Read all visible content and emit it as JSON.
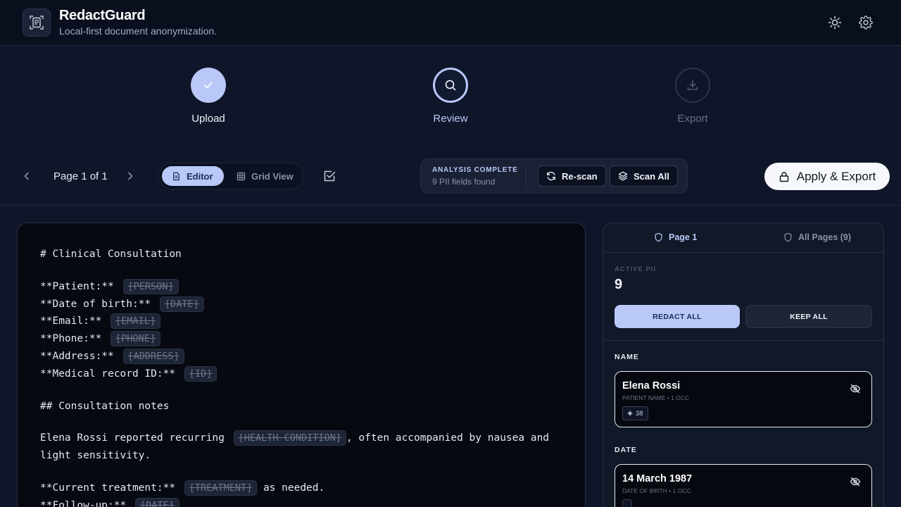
{
  "app": {
    "title": "RedactGuard",
    "subtitle": "Local-first document anonymization."
  },
  "header": {
    "icons": [
      "theme-toggle-icon",
      "gear-icon"
    ]
  },
  "stepper": {
    "steps": [
      {
        "label": "Upload",
        "state": "done",
        "icon": "check-icon"
      },
      {
        "label": "Review",
        "state": "active",
        "icon": "search-icon"
      },
      {
        "label": "Export",
        "state": "pending",
        "icon": "download-icon"
      }
    ]
  },
  "toolbar": {
    "page_indicator": "Page 1 of 1",
    "views": [
      {
        "label": "Editor",
        "active": true
      },
      {
        "label": "Grid View",
        "active": false
      }
    ],
    "analysis": {
      "status": "ANALYSIS COMPLETE",
      "count_text": "9 PII fields found",
      "rescan_label": "Re-scan",
      "scan_all_label": "Scan All"
    },
    "apply_export_label": "Apply & Export"
  },
  "editor": {
    "heading": "# Clinical Consultation",
    "fields": [
      {
        "label": "**Patient:**",
        "tag": "[PERSON]"
      },
      {
        "label": "**Date of birth:**",
        "tag": "[DATE]"
      },
      {
        "label": "**Email:**",
        "tag": "[EMAIL]"
      },
      {
        "label": "**Phone:**",
        "tag": "[PHONE]"
      },
      {
        "label": "**Address:**",
        "tag": "[ADDRESS]"
      },
      {
        "label": "**Medical record ID:**",
        "tag": "[ID]"
      }
    ],
    "notes_heading": "## Consultation notes",
    "paragraph": {
      "before": "Elena Rossi reported recurring",
      "tag": "[HEALTH CONDITION]",
      "after": ", often accompanied by nausea and light sensitivity."
    },
    "treatment": {
      "label": "**Current treatment:**",
      "tag": "[TREATMENT]",
      "after": "as needed."
    },
    "followup": {
      "label": "**Follow-up:**",
      "tag": "[DATE]"
    }
  },
  "panel": {
    "tabs": [
      {
        "label": "Page 1",
        "active": true
      },
      {
        "label": "All Pages (9)",
        "active": false
      }
    ],
    "active_label": "ACTIVE PII",
    "active_count": "9",
    "redact_all_label": "REDACT ALL",
    "keep_all_label": "KEEP ALL",
    "groups": [
      {
        "title": "NAME",
        "entity": {
          "name": "Elena Rossi",
          "meta": "PATIENT NAME • 1 OCC",
          "badge": "38"
        }
      },
      {
        "title": "DATE",
        "entity": {
          "name": "14 March 1987",
          "meta": "DATE OF BIRTH • 1 OCC",
          "badge": ""
        }
      }
    ]
  },
  "colors": {
    "accent": "#b9c8f8",
    "background": "#0f1629",
    "header_bg": "#0a0f1e",
    "editor_bg": "#06090f",
    "panel_bg": "#111827"
  }
}
